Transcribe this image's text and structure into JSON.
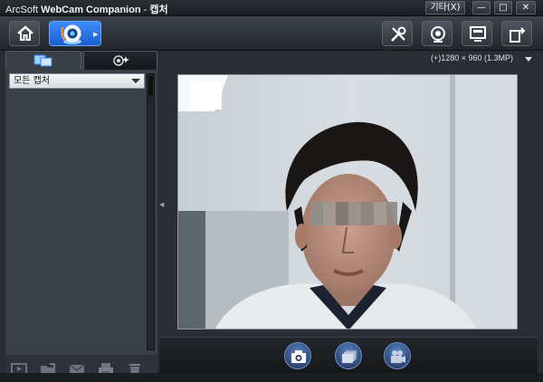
{
  "window": {
    "app_name_prefix": "ArcSoft",
    "app_name_main": "WebCam Companion",
    "title_separator": " - ",
    "page_name": "캡처",
    "etc_button_label": "기타(X)",
    "minimize_label": "—",
    "maximize_label": "□",
    "close_label": "✕"
  },
  "toolbar": {
    "home_icon": "home-icon",
    "webcam_icon": "webcam-icon",
    "tools_icon": "tools-icon",
    "camera_settings_icon": "camera-settings-icon",
    "display_icon": "display-icon",
    "export_icon": "export-icon"
  },
  "sidebar": {
    "tabs": [
      {
        "icon": "captures-icon",
        "selected": true
      },
      {
        "icon": "effects-icon",
        "selected": false
      }
    ],
    "filter": {
      "selected": "모든 캡처"
    },
    "bottom_icons": [
      "slideshow-icon",
      "open-folder-icon",
      "email-icon",
      "print-icon",
      "delete-icon"
    ]
  },
  "preview": {
    "resolution": "(+)1280 × 960 (1.3MP)"
  },
  "capture_bar": {
    "buttons": [
      "photo-capture-icon",
      "burst-capture-icon",
      "video-record-icon"
    ]
  },
  "colors": {
    "accent": "#2f7bef",
    "background": "#2a2d33",
    "panel": "#3a3e45"
  }
}
